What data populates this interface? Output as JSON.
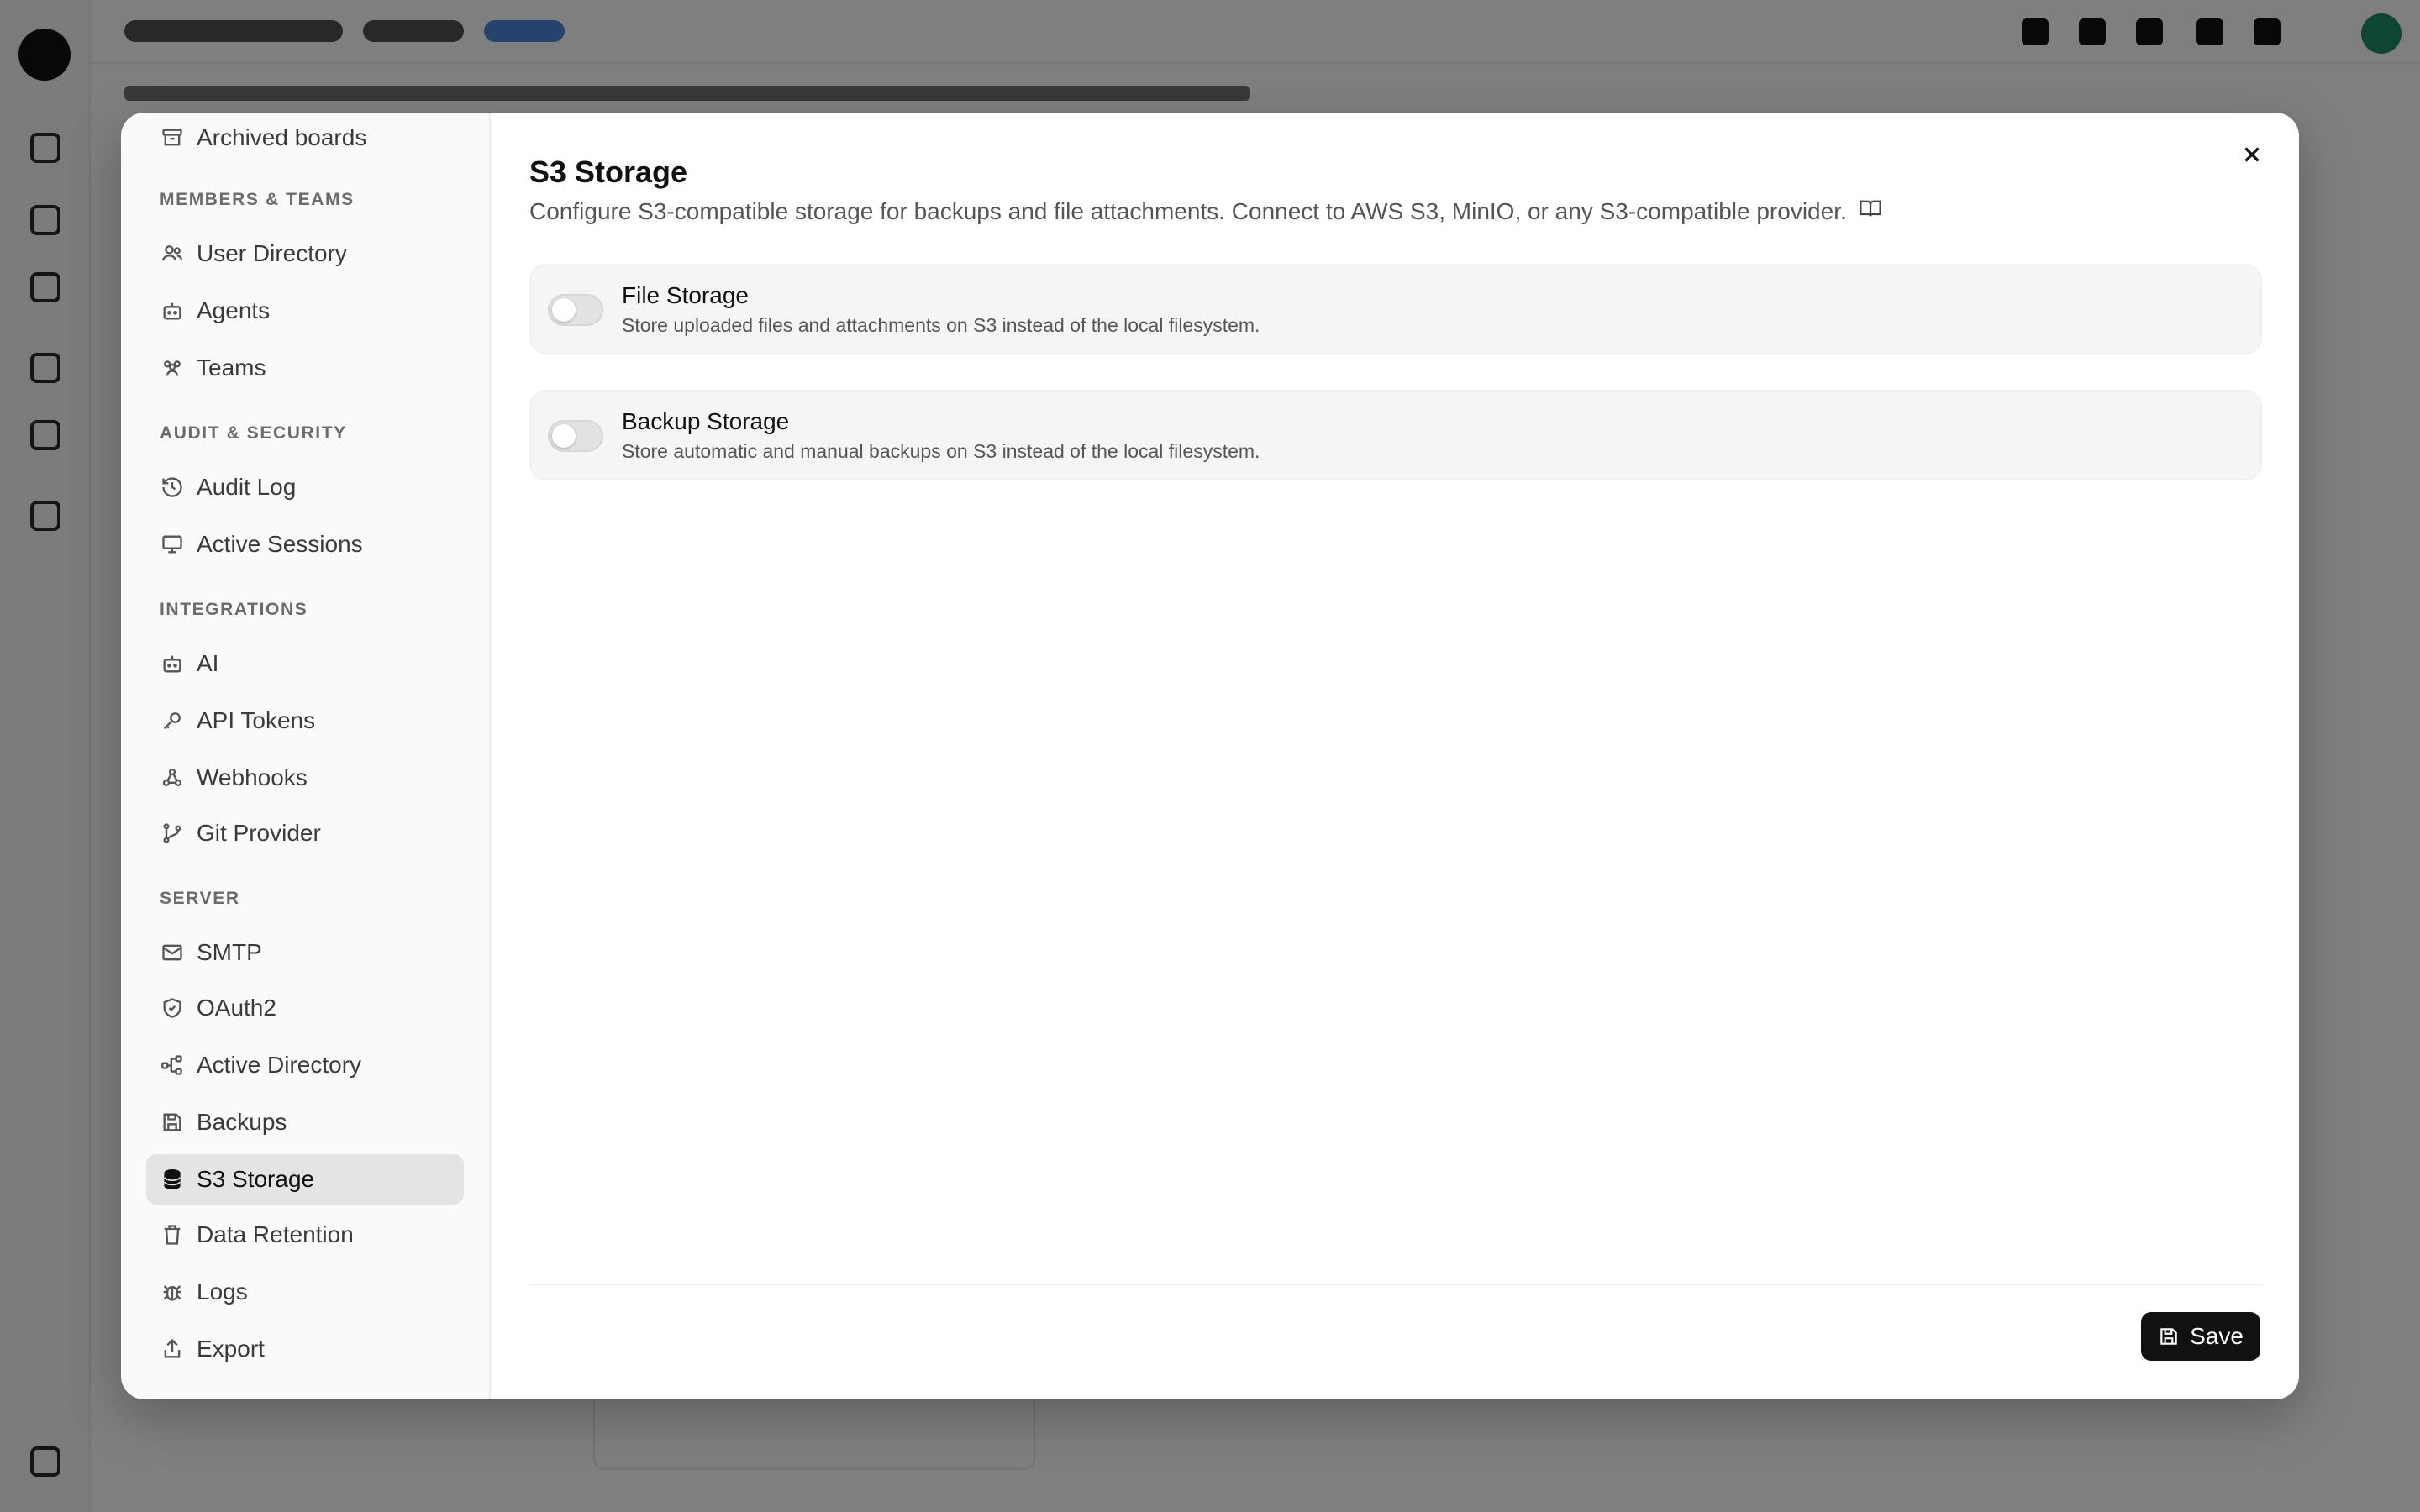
{
  "modal": {
    "title": "S3 Storage",
    "subtitle": "Configure S3-compatible storage for backups and file attachments. Connect to AWS S3, MinIO, or any S3-compatible provider.",
    "close_icon": "close-icon",
    "docs_icon": "book-open-icon"
  },
  "sidebar": {
    "top_item": {
      "label": "Archived boards",
      "icon": "archive-icon"
    },
    "sections": [
      {
        "heading": "MEMBERS & TEAMS",
        "items": [
          {
            "label": "User Directory",
            "icon": "users-icon"
          },
          {
            "label": "Agents",
            "icon": "bot-icon"
          },
          {
            "label": "Teams",
            "icon": "team-icon"
          }
        ]
      },
      {
        "heading": "AUDIT & SECURITY",
        "items": [
          {
            "label": "Audit Log",
            "icon": "history-icon"
          },
          {
            "label": "Active Sessions",
            "icon": "monitor-icon"
          }
        ]
      },
      {
        "heading": "INTEGRATIONS",
        "items": [
          {
            "label": "AI",
            "icon": "bot-icon"
          },
          {
            "label": "API Tokens",
            "icon": "key-icon"
          },
          {
            "label": "Webhooks",
            "icon": "webhook-icon"
          },
          {
            "label": "Git Provider",
            "icon": "git-branch-icon"
          }
        ]
      },
      {
        "heading": "SERVER",
        "items": [
          {
            "label": "SMTP",
            "icon": "mail-icon"
          },
          {
            "label": "OAuth2",
            "icon": "shield-icon"
          },
          {
            "label": "Active Directory",
            "icon": "network-icon"
          },
          {
            "label": "Backups",
            "icon": "save-icon"
          },
          {
            "label": "S3 Storage",
            "icon": "database-icon",
            "active": true
          },
          {
            "label": "Data Retention",
            "icon": "trash-icon"
          },
          {
            "label": "Logs",
            "icon": "bug-icon"
          },
          {
            "label": "Export",
            "icon": "share-icon"
          }
        ]
      }
    ]
  },
  "settings": [
    {
      "title": "File Storage",
      "description": "Store uploaded files and attachments on S3 instead of the local filesystem.",
      "enabled": false
    },
    {
      "title": "Backup Storage",
      "description": "Store automatic and manual backups on S3 instead of the local filesystem.",
      "enabled": false
    }
  ],
  "footer": {
    "save_label": "Save",
    "save_icon": "save-icon"
  },
  "colors": {
    "accent": "#111111",
    "active_bg": "#e4e4e4",
    "card_bg": "#f5f5f5",
    "overlay": "rgba(0,0,0,0.5)"
  }
}
